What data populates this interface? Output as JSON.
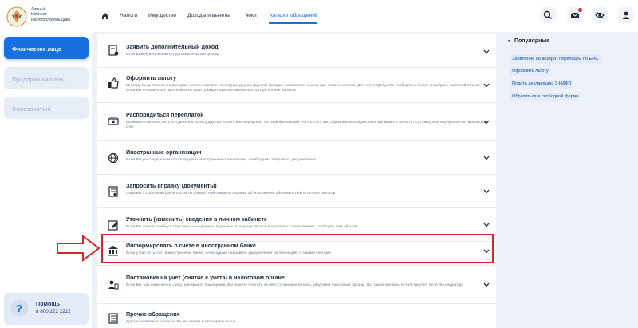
{
  "brand": {
    "lines": [
      "Личный",
      "Кабинет",
      "Налогоплательщика"
    ]
  },
  "roles": [
    "Физическое лицо",
    "Предприниматель",
    "Самозанятый"
  ],
  "help": {
    "title": "Помощь",
    "phone": "8 800 222 2222"
  },
  "nav": {
    "items": [
      "Налоги",
      "Имущество",
      "Доходы и вычеты",
      "Чеки",
      "Каталог обращений"
    ],
    "active_index": 4
  },
  "toolbar": {
    "icons": [
      "search-icon",
      "mail-icon",
      "eye-off-icon",
      "user-icon"
    ]
  },
  "catalog": [
    {
      "icon": "document-plus-icon",
      "title": "Заявить дополнительный доход",
      "desc": "Если Вам нужно заявить о дополнительном доходе"
    },
    {
      "icon": "thumb-up-icon",
      "title": "Оформить льготу",
      "desc": "Многодетным семьям, инвалидам, пенсионерам и некоторым другим группам граждан полагаются льготы при оплате налогов. Для этого требуется сообщить о льготе и выбрать льготный объект. Если Вы относитесь к льготной категории граждан Вам положены льготы при оплате налогов"
    },
    {
      "icon": "money-icon",
      "title": "Распорядиться переплатой",
      "desc": "Вы можете перечислить эти деньги в оплату другого налога или вернуть их на свой банковский счет. Если у вас образовалась переплата. Вы можете зачесть эту сумму или вернуть ее на банковский счет"
    },
    {
      "icon": "globe-icon",
      "title": "Иностранные организации",
      "desc": "Если Вы участвуете или контролируете иностранные организации, необходимо направить уведомление"
    },
    {
      "icon": "certificate-icon",
      "title": "Запросить справку (документы)",
      "desc": "Справки о состоянии расчетов, акты совместной сверки и справки об исполнении обязанностей по оплате налогов"
    },
    {
      "icon": "edit-profile-icon",
      "title": "Уточнить (изменить) сведения в личном кабинете",
      "desc": "Если Вы нашли ошибку в персональных данных, в данных по имуществу или в налоговых начислениях, сообщите нам об этом"
    },
    {
      "icon": "bank-icon",
      "title": "Информировать о счете в иностранном банке",
      "desc": "Если у Вас есть счет в иностранном банке, необходимо направить уведомление об операциях с такими счетами"
    },
    {
      "icon": "person-doc-icon",
      "title": "Постановка на учет (снятие с учета) в налоговом органе",
      "desc": "Если Вы, как физическое лицо, нанимаете помощника, Вы можете платить за него страховые взносы, уведомив налоговые органы. Вы также обязаны встать на учет, если Вы медиатор"
    },
    {
      "icon": "list-icon",
      "title": "Прочие обращения",
      "desc": "Другие заявления, которые Вы не нашли в категориях выше"
    }
  ],
  "popular": {
    "title": "Популярные",
    "items": [
      "Заявление на возврат переплаты по ЕНС",
      "Оформить льготу",
      "Подать декларацию 3-НДФЛ",
      "Обратиться в свободной форме"
    ]
  }
}
